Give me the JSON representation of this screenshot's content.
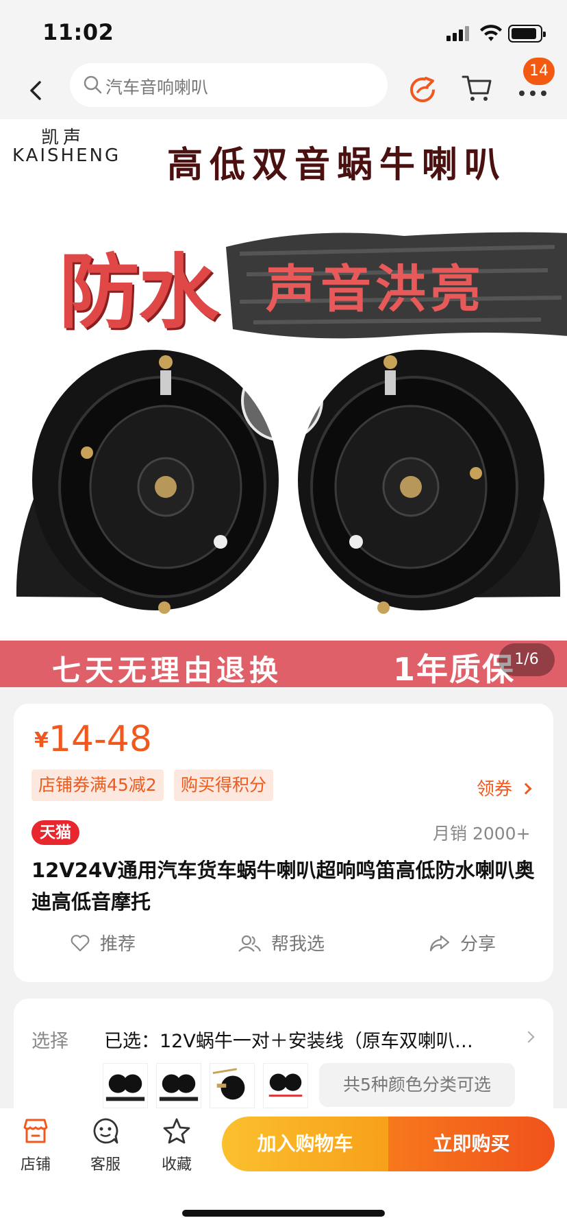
{
  "status_bar": {
    "time": "11:02"
  },
  "nav": {
    "search_placeholder": "汽车音响喇叭",
    "message_count": "14"
  },
  "hero": {
    "brand_cn": "凯声",
    "brand_en": "KAISHENG",
    "title": "高低双音蜗牛喇叭",
    "slogan_big": "防水",
    "slogan_sub": "声音洪亮",
    "guarantee_left": "七天无理由退换",
    "guarantee_right": "1年质保",
    "counter": "1/6"
  },
  "product": {
    "currency": "¥",
    "price": "14-48",
    "tags": [
      "店铺券满45减2",
      "购买得积分"
    ],
    "coupon_label": "领券",
    "platform_badge": "天猫",
    "monthly_sales": "月销 2000+",
    "title": "12V24V通用汽车货车蜗牛喇叭超响鸣笛高低防水喇叭奥迪高低音摩托",
    "actions": {
      "recommend": "推荐",
      "help_choose": "帮我选",
      "share": "分享"
    }
  },
  "spec": {
    "label": "选择",
    "selected": "已选：12V蜗牛一对＋安装线（原车双喇叭…",
    "colors_available": "共5种颜色分类可选"
  },
  "bottom_bar": {
    "store": "店铺",
    "service": "客服",
    "favorite": "收藏",
    "add_to_cart": "加入购物车",
    "buy_now": "立即购买"
  },
  "colors": {
    "accent": "#f0581d",
    "tmall_red": "#e8262e",
    "cart_yellow": "#fbc02d"
  }
}
